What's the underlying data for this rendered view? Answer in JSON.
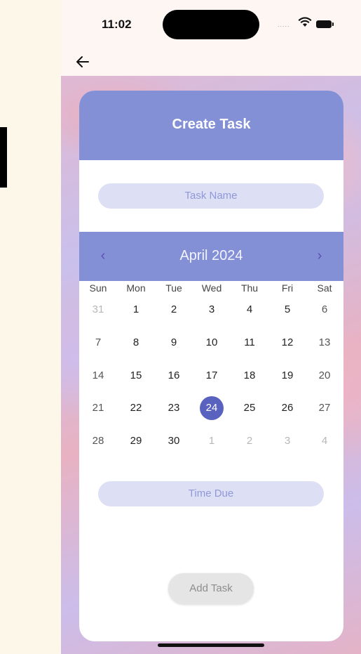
{
  "status_bar": {
    "time": "11:02",
    "signal": "....."
  },
  "header": {
    "title": "Create Task"
  },
  "task_name": {
    "placeholder": "Task Name"
  },
  "calendar": {
    "month_label": "April 2024",
    "prev_icon": "chevron-left-icon",
    "next_icon": "chevron-right-icon",
    "weekdays": [
      "Sun",
      "Mon",
      "Tue",
      "Wed",
      "Thu",
      "Fri",
      "Sat"
    ],
    "weeks": [
      [
        "31",
        "1",
        "2",
        "3",
        "4",
        "5",
        "6"
      ],
      [
        "7",
        "8",
        "9",
        "10",
        "11",
        "12",
        "13"
      ],
      [
        "14",
        "15",
        "16",
        "17",
        "18",
        "19",
        "20"
      ],
      [
        "21",
        "22",
        "23",
        "24",
        "25",
        "26",
        "27"
      ],
      [
        "28",
        "29",
        "30",
        "1",
        "2",
        "3",
        "4"
      ]
    ],
    "selected_day": "24",
    "accent_color": "#8390d6",
    "selected_color": "#5a62bf"
  },
  "time_due": {
    "placeholder": "Time Due"
  },
  "add_button": {
    "label": "Add Task"
  }
}
